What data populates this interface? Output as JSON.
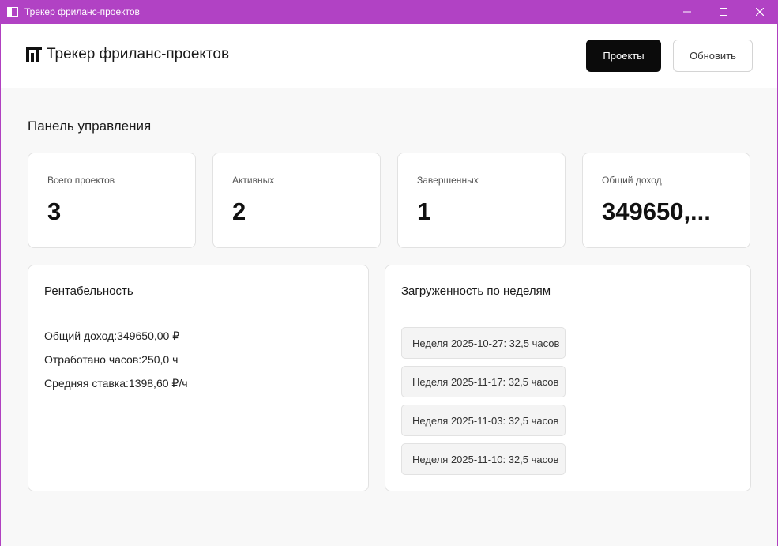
{
  "window": {
    "title": "Трекер фриланс-проектов"
  },
  "header": {
    "app_title": "Трекер фриланс-проектов",
    "projects_button": "Проекты",
    "refresh_button": "Обновить"
  },
  "dashboard": {
    "title": "Панель управления",
    "stats": [
      {
        "label": "Всего проектов",
        "value": "3"
      },
      {
        "label": "Активных",
        "value": "2"
      },
      {
        "label": "Завершенных",
        "value": "1"
      },
      {
        "label": "Общий доход",
        "value": "349650,..."
      }
    ]
  },
  "profitability": {
    "title": "Рентабельность",
    "metrics": [
      "Общий доход:349650,00 ₽",
      "Отработано часов:250,0 ч",
      "Средняя ставка:1398,60 ₽/ч"
    ]
  },
  "workload": {
    "title": "Загруженность по неделям",
    "weeks": [
      "Неделя 2025-10-27: 32,5 часов",
      "Неделя 2025-11-17: 32,5 часов",
      "Неделя 2025-11-03: 32,5 часов",
      "Неделя 2025-11-10: 32,5 часов"
    ]
  }
}
